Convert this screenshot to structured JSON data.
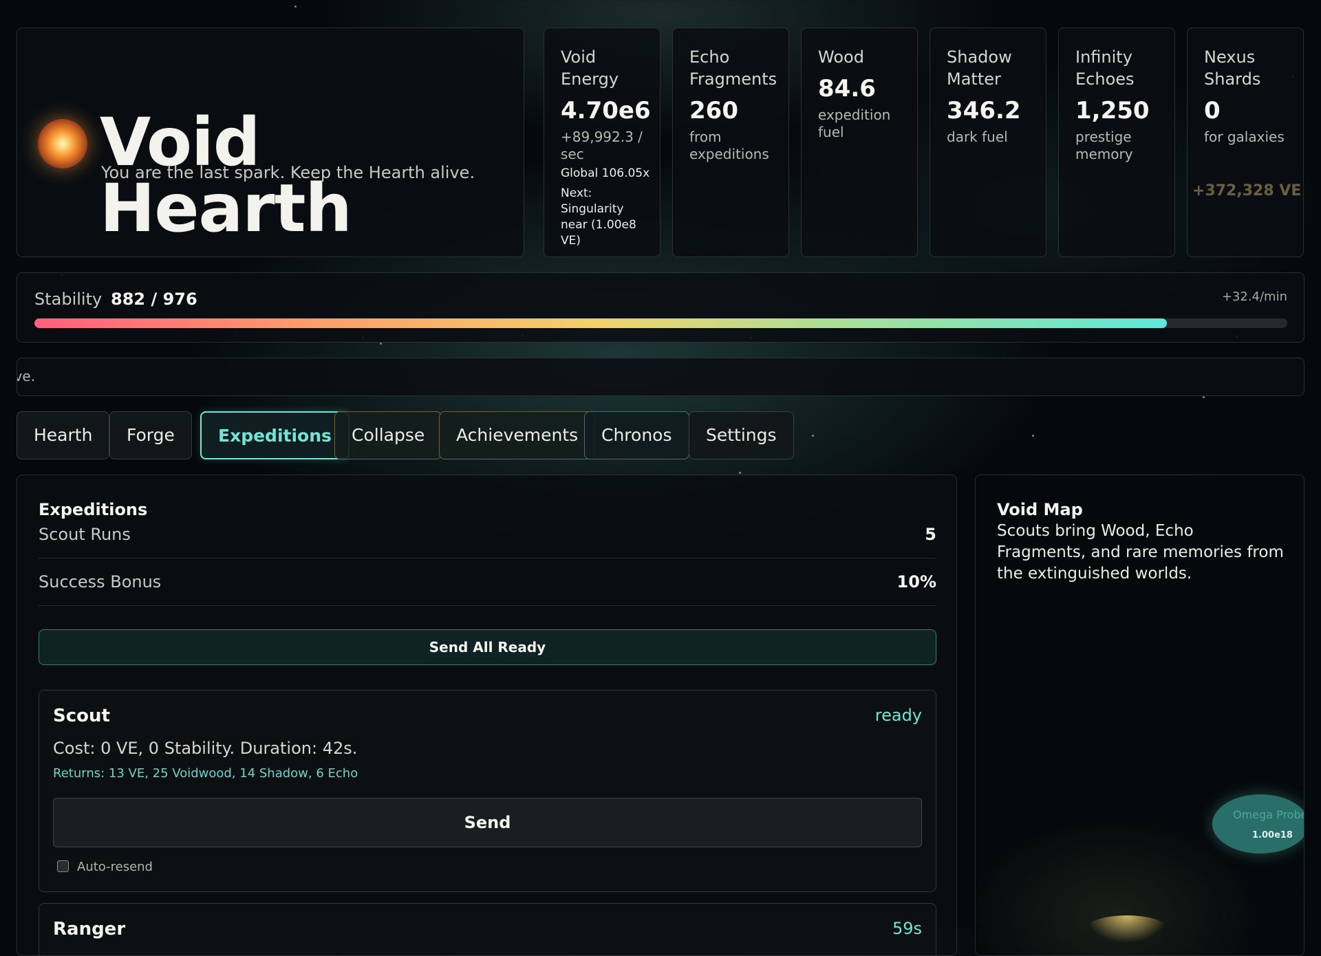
{
  "header": {
    "title": "Void Hearth",
    "tagline": "You are the last spark. Keep the Hearth alive."
  },
  "resources": [
    {
      "name": "Void Energy",
      "value": "4.70e6",
      "sub": "+89,992.3 / sec",
      "extra": [
        "Global 106.05x",
        "Next:",
        "Singularity near (1.00e8 VE)"
      ]
    },
    {
      "name": "Echo Fragments",
      "value": "260",
      "sub": "from expeditions"
    },
    {
      "name": "Wood",
      "value": "84.6",
      "sub": "expedition fuel"
    },
    {
      "name": "Shadow Matter",
      "value": "346.2",
      "sub": "dark fuel"
    },
    {
      "name": "Infinity Echoes",
      "value": "1,250",
      "sub": "prestige memory"
    },
    {
      "name": "Nexus Shards",
      "value": "0",
      "sub": "for galaxies",
      "popup": "+372,328 VE"
    }
  ],
  "stability": {
    "label": "Stability",
    "value": "882 / 976",
    "rate": "+32.4/min",
    "fraction": 0.9037
  },
  "ticker": {
    "text": "ive."
  },
  "tabs": [
    {
      "label": "Hearth",
      "active": false
    },
    {
      "label": "Forge",
      "active": false
    },
    {
      "label": "Expeditions",
      "active": true
    },
    {
      "label": "Collapse",
      "active": false
    },
    {
      "label": "Achievements",
      "active": false
    },
    {
      "label": "Chronos",
      "active": false
    },
    {
      "label": "Settings",
      "active": false
    }
  ],
  "expeditions": {
    "heading": "Expeditions",
    "stats": [
      {
        "label": "Scout Runs",
        "value": "5"
      },
      {
        "label": "Success Bonus",
        "value": "10%"
      }
    ],
    "send_all_label": "Send All Ready",
    "cards": [
      {
        "name": "Scout",
        "status": "ready",
        "cost": "Cost: 0 VE, 0 Stability. Duration: 42s.",
        "returns": "Returns: 13 VE, 25 Voidwood, 14 Shadow, 6 Echo",
        "send_label": "Send",
        "auto_resend_label": "Auto-resend"
      },
      {
        "name": "Ranger",
        "status": "59s"
      }
    ]
  },
  "void_map": {
    "heading": "Void Map",
    "description": "Scouts bring Wood, Echo Fragments, and rare memories from the extinguished worlds.",
    "nodes": [
      {
        "name": "Omega Probe",
        "value": "1.00e18"
      }
    ]
  },
  "colors": {
    "accent": "#6fe6d8",
    "background": "#05090c",
    "stability_gradient": [
      "#ff5f7e",
      "#f0d270",
      "#5fe6d9"
    ]
  }
}
